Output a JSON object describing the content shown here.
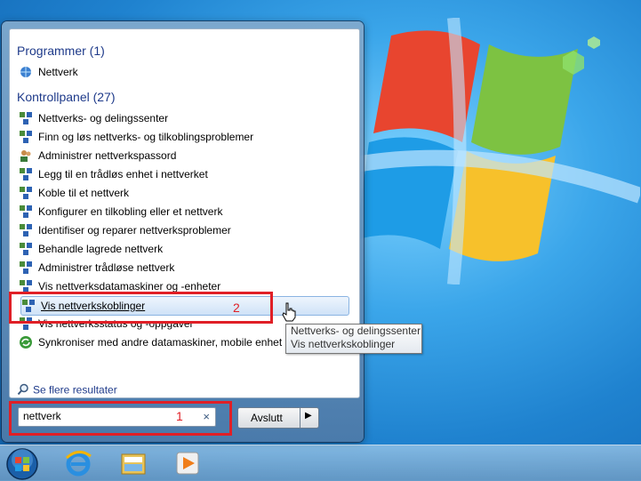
{
  "start_menu": {
    "groups": [
      {
        "heading": "Programmer (1)",
        "items": [
          "Nettverk"
        ]
      },
      {
        "heading": "Kontrollpanel (27)",
        "items": [
          "Nettverks- og delingssenter",
          "Finn og løs nettverks- og tilkoblingsproblemer",
          "Administrer nettverkspassord",
          "Legg til en trådløs enhet i nettverket",
          "Koble til et nettverk",
          "Konfigurer en tilkobling eller et nettverk",
          "Identifiser og reparer nettverksproblemer",
          "Behandle lagrede nettverk",
          "Administrer trådløse nettverk",
          "Vis nettverksdatamaskiner og -enheter",
          "Vis nettverkskoblinger",
          "Vis nettverksstatus og -oppgaver",
          "Synkroniser med andre datamaskiner, mobile enhet"
        ]
      }
    ],
    "see_more": "Se flere resultater",
    "search_value": "nettverk",
    "clear_glyph": "×",
    "shutdown_label": "Avslutt",
    "shutdown_arrow": "▶"
  },
  "tooltip": {
    "line1": "Nettverks- og delingssenter",
    "line2": "Vis nettverkskoblinger"
  },
  "annotations": {
    "box1": "1",
    "box2": "2"
  },
  "colors": {
    "highlight_box": "#e01f26",
    "heading": "#1e3a8a"
  }
}
